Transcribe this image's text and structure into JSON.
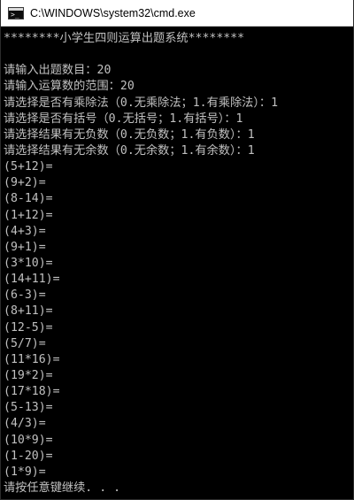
{
  "window": {
    "title": "C:\\WINDOWS\\system32\\cmd.exe",
    "icon": "cmd-icon",
    "icon_text": ">_"
  },
  "console": {
    "lines": [
      "********小学生四则运算出题系统********",
      "",
      "请输入出题数目：20",
      "请输入运算数的范围：20",
      "请选择是否有乘除法（0.无乘除法；1.有乘除法）：1",
      "请选择是否有括号（0.无括号；1.有括号）：1",
      "请选择结果有无负数（0.无负数；1.有负数）：1",
      "请选择结果有无余数（0.无余数；1.有余数）：1",
      "(5+12)=",
      "(9+2)=",
      "(8-14)=",
      "(1+12)=",
      "(4+3)=",
      "(9+1)=",
      "(3*10)=",
      "(14+11)=",
      "(6-3)=",
      "(8+11)=",
      "(12-5)=",
      "(5/7)=",
      "(11*16)=",
      "(19*2)=",
      "(17*18)=",
      "(5-13)=",
      "(4/3)=",
      "(10*9)=",
      "(1-20)=",
      "(1*9)=",
      "请按任意键继续. . ."
    ]
  },
  "colors": {
    "console_bg": "#000000",
    "console_text": "#c0c0c0",
    "titlebar_bg": "#ffffff"
  }
}
